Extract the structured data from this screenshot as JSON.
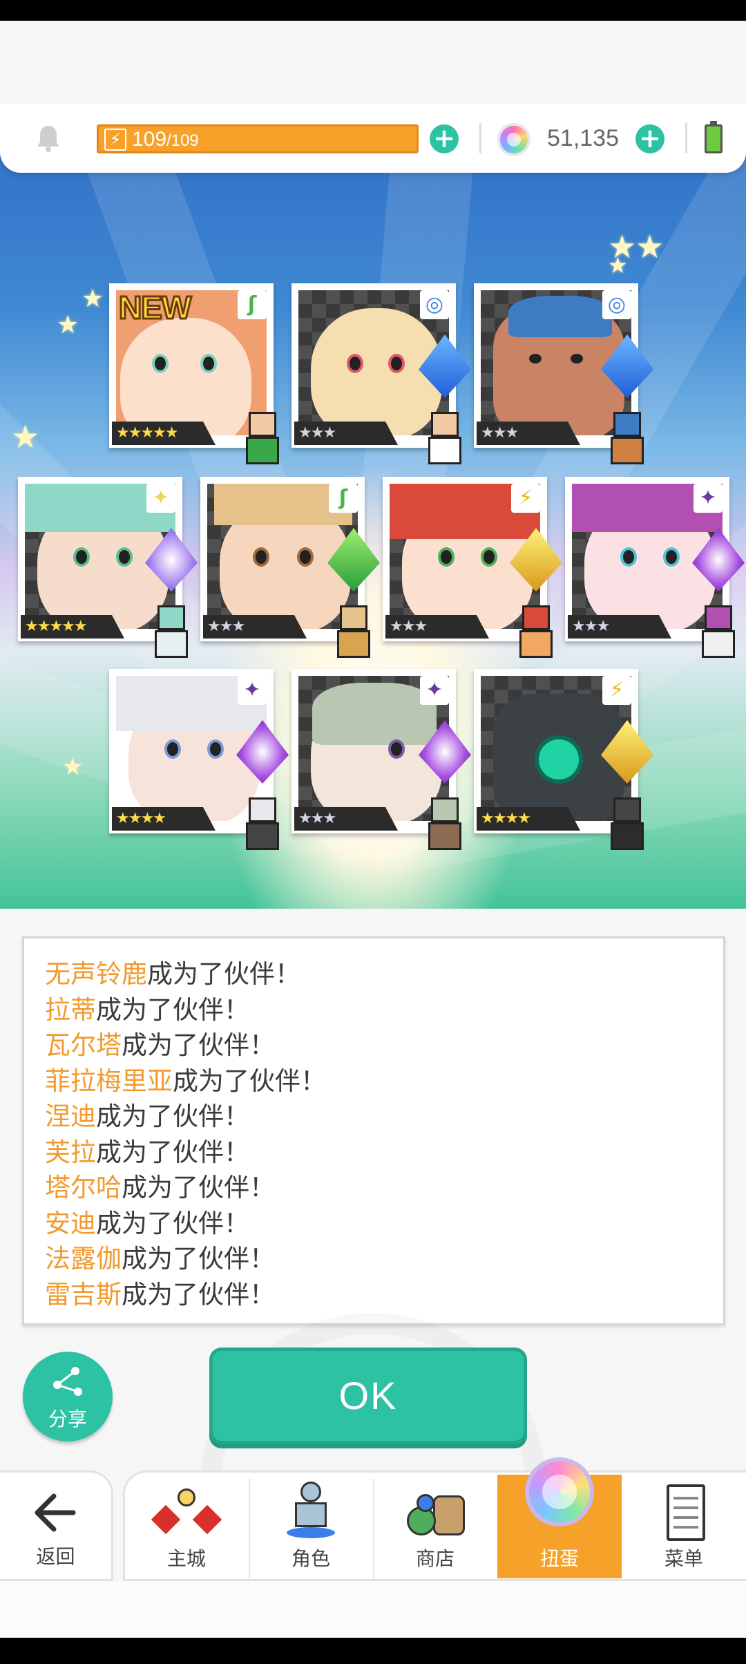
{
  "resources": {
    "energy_current": "109",
    "energy_max": "/109",
    "gems": "51,135"
  },
  "cards": [
    {
      "name_hint": "new-hero",
      "stars": "★★★★★",
      "star_color": "gold",
      "is_new": true,
      "new_label": "NEW",
      "element": "leaf",
      "element_icon": "ʃ"
    },
    {
      "name_hint": "hero-2",
      "stars": "★★★",
      "star_color": "silver",
      "element": "water"
    },
    {
      "name_hint": "hero-3",
      "stars": "★★★",
      "star_color": "silver",
      "element": "water"
    },
    {
      "name_hint": "hero-4",
      "stars": "★★★★★",
      "star_color": "gold",
      "element": "light"
    },
    {
      "name_hint": "hero-5",
      "stars": "★★★",
      "star_color": "silver",
      "element": "leaf"
    },
    {
      "name_hint": "hero-6",
      "stars": "★★★",
      "star_color": "silver",
      "element": "thunder"
    },
    {
      "name_hint": "hero-7",
      "stars": "★★★",
      "star_color": "silver",
      "element": "dark"
    },
    {
      "name_hint": "hero-8",
      "stars": "★★★★",
      "star_color": "gold",
      "element": "dark"
    },
    {
      "name_hint": "hero-9",
      "stars": "★★★",
      "star_color": "silver",
      "element": "dark"
    },
    {
      "name_hint": "hero-10",
      "stars": "★★★★",
      "star_color": "gold",
      "element": "thunder"
    }
  ],
  "messages": [
    {
      "name": "无声铃鹿",
      "suffix": "成为了伙伴！"
    },
    {
      "name": "拉蒂",
      "suffix": "成为了伙伴！"
    },
    {
      "name": "瓦尔塔",
      "suffix": "成为了伙伴！"
    },
    {
      "name": "菲拉梅里亚",
      "suffix": "成为了伙伴！"
    },
    {
      "name": "涅迪",
      "suffix": "成为了伙伴！"
    },
    {
      "name": "芙拉",
      "suffix": "成为了伙伴！"
    },
    {
      "name": "塔尔哈",
      "suffix": "成为了伙伴！"
    },
    {
      "name": "安迪",
      "suffix": "成为了伙伴！"
    },
    {
      "name": "法露伽",
      "suffix": "成为了伙伴！"
    },
    {
      "name": "雷吉斯",
      "suffix": "成为了伙伴！"
    }
  ],
  "buttons": {
    "share": "分享",
    "ok": "OK"
  },
  "nav": {
    "back": "返回",
    "tabs": [
      "主城",
      "角色",
      "商店",
      "扭蛋",
      "菜单"
    ],
    "active": "扭蛋"
  },
  "colors": {
    "accent_teal": "#2ec2a4",
    "accent_orange": "#f6a12a",
    "name_orange": "#f29a2e"
  }
}
